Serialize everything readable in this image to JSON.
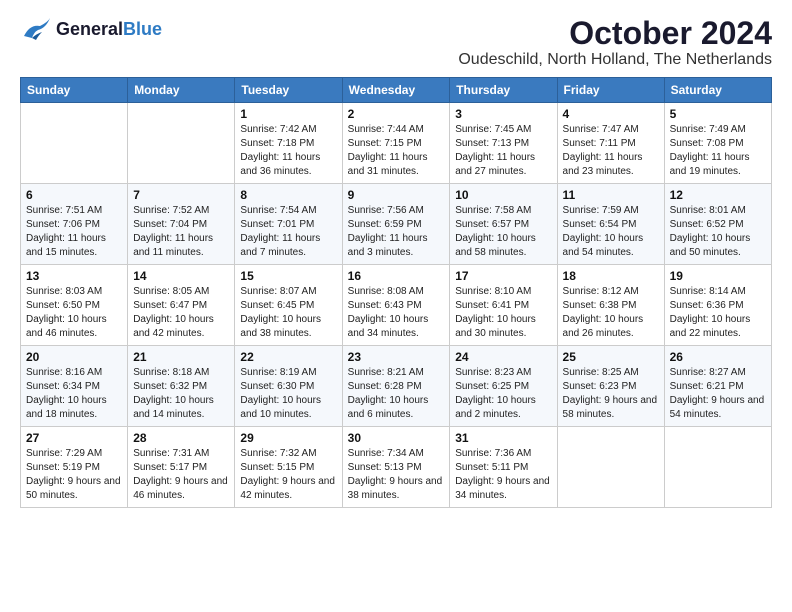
{
  "header": {
    "logo_general": "General",
    "logo_blue": "Blue",
    "title": "October 2024",
    "subtitle": "Oudeschild, North Holland, The Netherlands"
  },
  "columns": [
    "Sunday",
    "Monday",
    "Tuesday",
    "Wednesday",
    "Thursday",
    "Friday",
    "Saturday"
  ],
  "weeks": [
    [
      {
        "num": "",
        "detail": ""
      },
      {
        "num": "",
        "detail": ""
      },
      {
        "num": "1",
        "detail": "Sunrise: 7:42 AM\nSunset: 7:18 PM\nDaylight: 11 hours and 36 minutes."
      },
      {
        "num": "2",
        "detail": "Sunrise: 7:44 AM\nSunset: 7:15 PM\nDaylight: 11 hours and 31 minutes."
      },
      {
        "num": "3",
        "detail": "Sunrise: 7:45 AM\nSunset: 7:13 PM\nDaylight: 11 hours and 27 minutes."
      },
      {
        "num": "4",
        "detail": "Sunrise: 7:47 AM\nSunset: 7:11 PM\nDaylight: 11 hours and 23 minutes."
      },
      {
        "num": "5",
        "detail": "Sunrise: 7:49 AM\nSunset: 7:08 PM\nDaylight: 11 hours and 19 minutes."
      }
    ],
    [
      {
        "num": "6",
        "detail": "Sunrise: 7:51 AM\nSunset: 7:06 PM\nDaylight: 11 hours and 15 minutes."
      },
      {
        "num": "7",
        "detail": "Sunrise: 7:52 AM\nSunset: 7:04 PM\nDaylight: 11 hours and 11 minutes."
      },
      {
        "num": "8",
        "detail": "Sunrise: 7:54 AM\nSunset: 7:01 PM\nDaylight: 11 hours and 7 minutes."
      },
      {
        "num": "9",
        "detail": "Sunrise: 7:56 AM\nSunset: 6:59 PM\nDaylight: 11 hours and 3 minutes."
      },
      {
        "num": "10",
        "detail": "Sunrise: 7:58 AM\nSunset: 6:57 PM\nDaylight: 10 hours and 58 minutes."
      },
      {
        "num": "11",
        "detail": "Sunrise: 7:59 AM\nSunset: 6:54 PM\nDaylight: 10 hours and 54 minutes."
      },
      {
        "num": "12",
        "detail": "Sunrise: 8:01 AM\nSunset: 6:52 PM\nDaylight: 10 hours and 50 minutes."
      }
    ],
    [
      {
        "num": "13",
        "detail": "Sunrise: 8:03 AM\nSunset: 6:50 PM\nDaylight: 10 hours and 46 minutes."
      },
      {
        "num": "14",
        "detail": "Sunrise: 8:05 AM\nSunset: 6:47 PM\nDaylight: 10 hours and 42 minutes."
      },
      {
        "num": "15",
        "detail": "Sunrise: 8:07 AM\nSunset: 6:45 PM\nDaylight: 10 hours and 38 minutes."
      },
      {
        "num": "16",
        "detail": "Sunrise: 8:08 AM\nSunset: 6:43 PM\nDaylight: 10 hours and 34 minutes."
      },
      {
        "num": "17",
        "detail": "Sunrise: 8:10 AM\nSunset: 6:41 PM\nDaylight: 10 hours and 30 minutes."
      },
      {
        "num": "18",
        "detail": "Sunrise: 8:12 AM\nSunset: 6:38 PM\nDaylight: 10 hours and 26 minutes."
      },
      {
        "num": "19",
        "detail": "Sunrise: 8:14 AM\nSunset: 6:36 PM\nDaylight: 10 hours and 22 minutes."
      }
    ],
    [
      {
        "num": "20",
        "detail": "Sunrise: 8:16 AM\nSunset: 6:34 PM\nDaylight: 10 hours and 18 minutes."
      },
      {
        "num": "21",
        "detail": "Sunrise: 8:18 AM\nSunset: 6:32 PM\nDaylight: 10 hours and 14 minutes."
      },
      {
        "num": "22",
        "detail": "Sunrise: 8:19 AM\nSunset: 6:30 PM\nDaylight: 10 hours and 10 minutes."
      },
      {
        "num": "23",
        "detail": "Sunrise: 8:21 AM\nSunset: 6:28 PM\nDaylight: 10 hours and 6 minutes."
      },
      {
        "num": "24",
        "detail": "Sunrise: 8:23 AM\nSunset: 6:25 PM\nDaylight: 10 hours and 2 minutes."
      },
      {
        "num": "25",
        "detail": "Sunrise: 8:25 AM\nSunset: 6:23 PM\nDaylight: 9 hours and 58 minutes."
      },
      {
        "num": "26",
        "detail": "Sunrise: 8:27 AM\nSunset: 6:21 PM\nDaylight: 9 hours and 54 minutes."
      }
    ],
    [
      {
        "num": "27",
        "detail": "Sunrise: 7:29 AM\nSunset: 5:19 PM\nDaylight: 9 hours and 50 minutes."
      },
      {
        "num": "28",
        "detail": "Sunrise: 7:31 AM\nSunset: 5:17 PM\nDaylight: 9 hours and 46 minutes."
      },
      {
        "num": "29",
        "detail": "Sunrise: 7:32 AM\nSunset: 5:15 PM\nDaylight: 9 hours and 42 minutes."
      },
      {
        "num": "30",
        "detail": "Sunrise: 7:34 AM\nSunset: 5:13 PM\nDaylight: 9 hours and 38 minutes."
      },
      {
        "num": "31",
        "detail": "Sunrise: 7:36 AM\nSunset: 5:11 PM\nDaylight: 9 hours and 34 minutes."
      },
      {
        "num": "",
        "detail": ""
      },
      {
        "num": "",
        "detail": ""
      }
    ]
  ]
}
